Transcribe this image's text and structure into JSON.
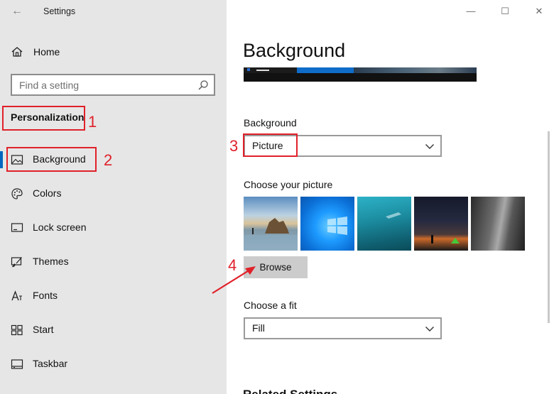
{
  "window": {
    "app_title": "Settings",
    "back_icon": "back-arrow-icon",
    "min_icon": "minimize-icon",
    "max_icon": "maximize-icon",
    "close_icon": "close-icon",
    "back_glyph": "←",
    "min_glyph": "—",
    "max_glyph": "☐",
    "close_glyph": "✕"
  },
  "sidebar": {
    "home_label": "Home",
    "search_placeholder": "Find a setting",
    "section_title": "Personalization",
    "items": [
      {
        "label": "Background",
        "icon": "picture-icon",
        "selected": true
      },
      {
        "label": "Colors",
        "icon": "palette-icon",
        "selected": false
      },
      {
        "label": "Lock screen",
        "icon": "lock-screen-icon",
        "selected": false
      },
      {
        "label": "Themes",
        "icon": "brush-icon",
        "selected": false
      },
      {
        "label": "Fonts",
        "icon": "font-icon",
        "selected": false
      },
      {
        "label": "Start",
        "icon": "start-grid-icon",
        "selected": false
      },
      {
        "label": "Taskbar",
        "icon": "taskbar-icon",
        "selected": false
      }
    ]
  },
  "main": {
    "page_title": "Background",
    "background_label": "Background",
    "background_value": "Picture",
    "choose_picture_label": "Choose your picture",
    "browse_label": "Browse",
    "choose_fit_label": "Choose a fit",
    "fit_value": "Fill",
    "next_heading": "Related Settings"
  },
  "annotations": {
    "n1": "1",
    "n2": "2",
    "n3": "3",
    "n4": "4",
    "color": "#e0212a"
  },
  "colors": {
    "accent": "#0067c0",
    "sidebar_bg": "#e6e6e6",
    "button_bg": "#cccccc"
  }
}
